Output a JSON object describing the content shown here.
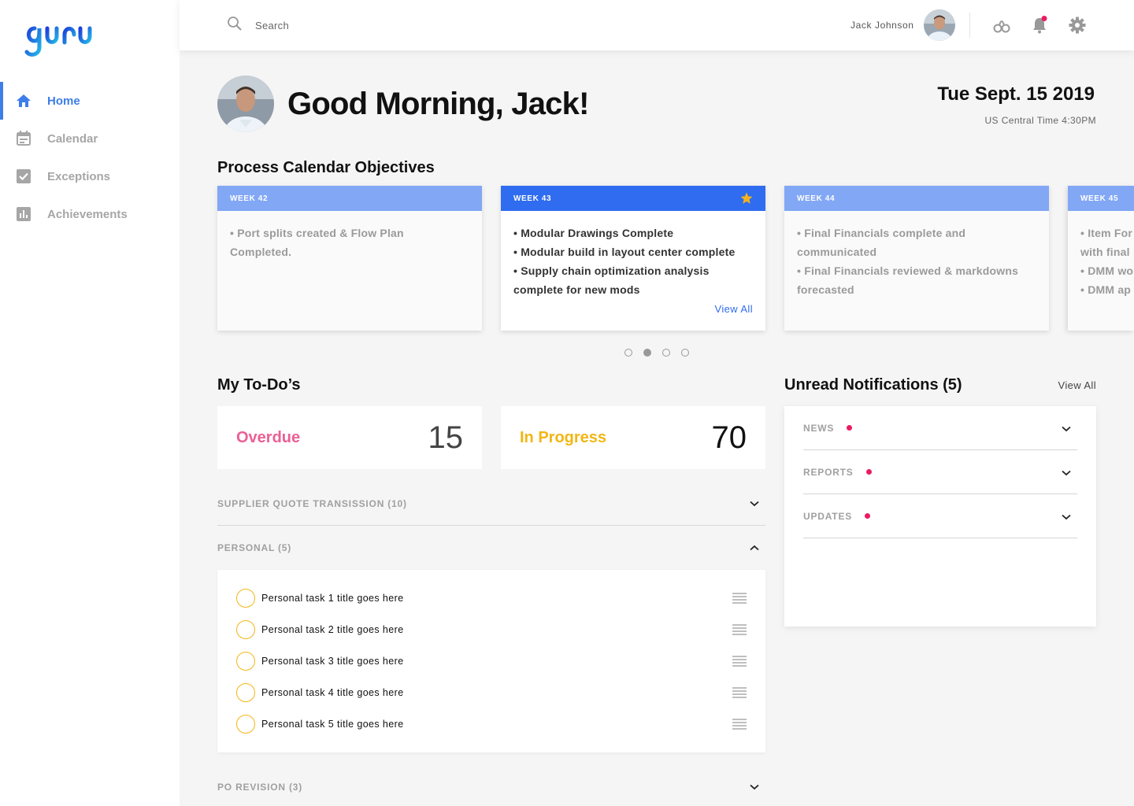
{
  "app": {
    "logo_text": "guru"
  },
  "sidebar": {
    "items": [
      {
        "label": "Home",
        "icon": "home-icon",
        "active": true
      },
      {
        "label": "Calendar",
        "icon": "calendar-icon"
      },
      {
        "label": "Exceptions",
        "icon": "checkbox-icon"
      },
      {
        "label": "Achievements",
        "icon": "bar-chart-icon"
      }
    ]
  },
  "header": {
    "search_placeholder": "Search",
    "user_name": "Jack Johnson",
    "icons": [
      "link-icon",
      "bell-icon",
      "gear-icon"
    ]
  },
  "greeting": {
    "text": "Good Morning, Jack!",
    "date": "Tue Sept. 15 2019",
    "timezone": "US Central Time 4:30PM"
  },
  "objectives": {
    "title": "Process Calendar Objectives",
    "view_all": "View All",
    "weeks": [
      {
        "label": "WEEK 42",
        "items": [
          "• Port splits created & Flow Plan",
          "Completed."
        ]
      },
      {
        "label": "WEEK 43",
        "starred": true,
        "items": [
          "• Modular Drawings Complete",
          "• Modular build in layout center complete",
          "• Supply chain optimization analysis",
          "complete for new mods"
        ]
      },
      {
        "label": "WEEK 44",
        "items": [
          "• Final Financials complete and",
          "communicated",
          "• Final Financials reviewed & markdowns",
          "forecasted"
        ]
      },
      {
        "label": "WEEK 45",
        "items": [
          "• Item For",
          "with final",
          "• DMM wo",
          "• DMM ap"
        ]
      }
    ],
    "pager_active": 2,
    "pager_count": 4
  },
  "todos": {
    "title": "My To-Do’s",
    "overdue_label": "Overdue",
    "overdue_count": "15",
    "inprogress_label": "In Progress",
    "inprogress_count": "70",
    "groups": [
      {
        "label": "SUPPLIER QUOTE TRANSISSION (10)",
        "expanded": false
      },
      {
        "label": "PERSONAL (5)",
        "expanded": true
      },
      {
        "label": "PO REVISION (3)",
        "expanded": false
      }
    ],
    "personal_tasks": [
      "Personal task 1 title goes here",
      "Personal task 2 title goes here",
      "Personal task 3 title goes here",
      "Personal task 4 title goes here",
      "Personal task 5 title goes here"
    ]
  },
  "notifications": {
    "title": "Unread Notifications (5)",
    "view_all": "View All",
    "items": [
      {
        "label": "NEWS",
        "unread": true
      },
      {
        "label": "REPORTS",
        "unread": true
      },
      {
        "label": "UPDATES",
        "unread": true
      }
    ]
  },
  "colors": {
    "brand_blue": "#2f6cf0",
    "nav_active": "#3d7ee8",
    "overdue": "#ec5f94",
    "in_progress": "#f2b614",
    "unread_dot": "#ea1b63"
  }
}
